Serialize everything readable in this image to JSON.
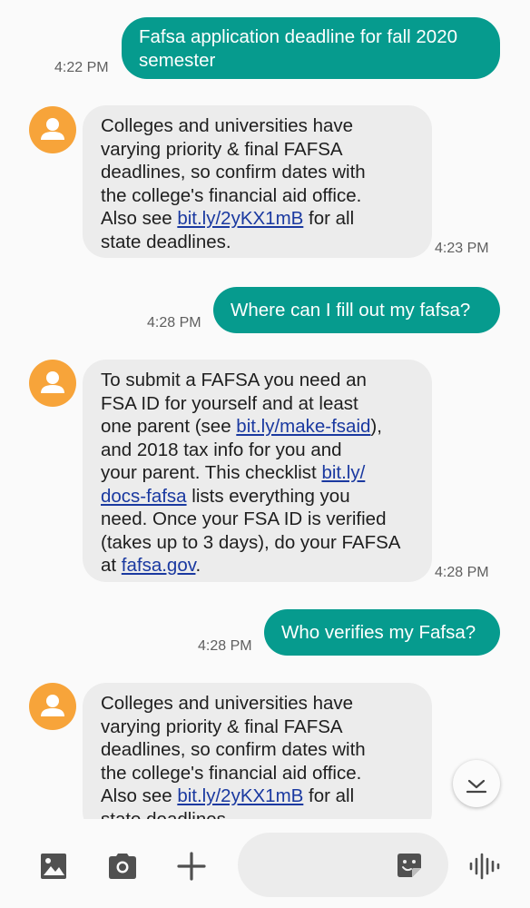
{
  "colors": {
    "accent": "#069b8e",
    "incoming_bubble": "#ececec",
    "avatar": "#f7a43a",
    "link": "#1a39a0"
  },
  "messages": [
    {
      "direction": "out",
      "text": "Fafsa application deadline for fall 2020\nsemester",
      "time": "4:22 PM"
    },
    {
      "direction": "in",
      "time": "4:23 PM",
      "text_a": "Colleges and universities have\nvarying priority & final FAFSA\ndeadlines, so  confirm dates with\nthe college's financial aid office.\nAlso see ",
      "link1": "bit.ly/2yKX1mB",
      "text_b": " for all\nstate deadlines."
    },
    {
      "direction": "out",
      "text": "Where can I fill out my fafsa?",
      "time": "4:28 PM"
    },
    {
      "direction": "in",
      "time": "4:28 PM",
      "text_a": "To submit a FAFSA you need an\nFSA ID for yourself and at least\none parent (see ",
      "link1": "bit.ly/make-fsaid",
      "text_b": "),\nand 2018 tax info for you and\nyour parent. This checklist ",
      "link2a": "bit.ly/",
      "link2b": "docs-fafsa",
      "text_c": " lists everything you\nneed. Once your FSA ID is verified\n(takes up to 3 days), do your FAFSA\nat ",
      "link3": "fafsa.gov",
      "text_d": "."
    },
    {
      "direction": "out",
      "text": "Who verifies my Fafsa?",
      "time": "4:28 PM"
    },
    {
      "direction": "in",
      "time": "",
      "text_a": "Colleges and universities have\nvarying priority & final FAFSA\ndeadlines, so  confirm dates with\nthe college's financial aid office.\nAlso see ",
      "link1": "bit.ly/2yKX1mB",
      "text_b": " for all\nstate deadlines."
    }
  ],
  "icons": {
    "gallery": "image-icon",
    "camera": "camera-icon",
    "add": "plus-icon",
    "sticker": "sticker-icon",
    "voice": "voice-icon",
    "scroll": "scroll-to-bottom-icon",
    "avatar": "person-icon"
  },
  "compose": {
    "value": "",
    "placeholder": ""
  }
}
